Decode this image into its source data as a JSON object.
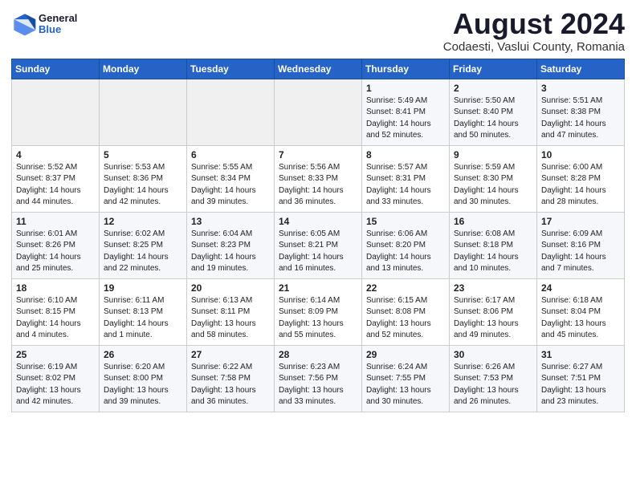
{
  "header": {
    "logo_general": "General",
    "logo_blue": "Blue",
    "main_title": "August 2024",
    "subtitle": "Codaesti, Vaslui County, Romania"
  },
  "days_of_week": [
    "Sunday",
    "Monday",
    "Tuesday",
    "Wednesday",
    "Thursday",
    "Friday",
    "Saturday"
  ],
  "weeks": [
    [
      {
        "day": "",
        "info": ""
      },
      {
        "day": "",
        "info": ""
      },
      {
        "day": "",
        "info": ""
      },
      {
        "day": "",
        "info": ""
      },
      {
        "day": "1",
        "info": "Sunrise: 5:49 AM\nSunset: 8:41 PM\nDaylight: 14 hours\nand 52 minutes."
      },
      {
        "day": "2",
        "info": "Sunrise: 5:50 AM\nSunset: 8:40 PM\nDaylight: 14 hours\nand 50 minutes."
      },
      {
        "day": "3",
        "info": "Sunrise: 5:51 AM\nSunset: 8:38 PM\nDaylight: 14 hours\nand 47 minutes."
      }
    ],
    [
      {
        "day": "4",
        "info": "Sunrise: 5:52 AM\nSunset: 8:37 PM\nDaylight: 14 hours\nand 44 minutes."
      },
      {
        "day": "5",
        "info": "Sunrise: 5:53 AM\nSunset: 8:36 PM\nDaylight: 14 hours\nand 42 minutes."
      },
      {
        "day": "6",
        "info": "Sunrise: 5:55 AM\nSunset: 8:34 PM\nDaylight: 14 hours\nand 39 minutes."
      },
      {
        "day": "7",
        "info": "Sunrise: 5:56 AM\nSunset: 8:33 PM\nDaylight: 14 hours\nand 36 minutes."
      },
      {
        "day": "8",
        "info": "Sunrise: 5:57 AM\nSunset: 8:31 PM\nDaylight: 14 hours\nand 33 minutes."
      },
      {
        "day": "9",
        "info": "Sunrise: 5:59 AM\nSunset: 8:30 PM\nDaylight: 14 hours\nand 30 minutes."
      },
      {
        "day": "10",
        "info": "Sunrise: 6:00 AM\nSunset: 8:28 PM\nDaylight: 14 hours\nand 28 minutes."
      }
    ],
    [
      {
        "day": "11",
        "info": "Sunrise: 6:01 AM\nSunset: 8:26 PM\nDaylight: 14 hours\nand 25 minutes."
      },
      {
        "day": "12",
        "info": "Sunrise: 6:02 AM\nSunset: 8:25 PM\nDaylight: 14 hours\nand 22 minutes."
      },
      {
        "day": "13",
        "info": "Sunrise: 6:04 AM\nSunset: 8:23 PM\nDaylight: 14 hours\nand 19 minutes."
      },
      {
        "day": "14",
        "info": "Sunrise: 6:05 AM\nSunset: 8:21 PM\nDaylight: 14 hours\nand 16 minutes."
      },
      {
        "day": "15",
        "info": "Sunrise: 6:06 AM\nSunset: 8:20 PM\nDaylight: 14 hours\nand 13 minutes."
      },
      {
        "day": "16",
        "info": "Sunrise: 6:08 AM\nSunset: 8:18 PM\nDaylight: 14 hours\nand 10 minutes."
      },
      {
        "day": "17",
        "info": "Sunrise: 6:09 AM\nSunset: 8:16 PM\nDaylight: 14 hours\nand 7 minutes."
      }
    ],
    [
      {
        "day": "18",
        "info": "Sunrise: 6:10 AM\nSunset: 8:15 PM\nDaylight: 14 hours\nand 4 minutes."
      },
      {
        "day": "19",
        "info": "Sunrise: 6:11 AM\nSunset: 8:13 PM\nDaylight: 14 hours\nand 1 minute."
      },
      {
        "day": "20",
        "info": "Sunrise: 6:13 AM\nSunset: 8:11 PM\nDaylight: 13 hours\nand 58 minutes."
      },
      {
        "day": "21",
        "info": "Sunrise: 6:14 AM\nSunset: 8:09 PM\nDaylight: 13 hours\nand 55 minutes."
      },
      {
        "day": "22",
        "info": "Sunrise: 6:15 AM\nSunset: 8:08 PM\nDaylight: 13 hours\nand 52 minutes."
      },
      {
        "day": "23",
        "info": "Sunrise: 6:17 AM\nSunset: 8:06 PM\nDaylight: 13 hours\nand 49 minutes."
      },
      {
        "day": "24",
        "info": "Sunrise: 6:18 AM\nSunset: 8:04 PM\nDaylight: 13 hours\nand 45 minutes."
      }
    ],
    [
      {
        "day": "25",
        "info": "Sunrise: 6:19 AM\nSunset: 8:02 PM\nDaylight: 13 hours\nand 42 minutes."
      },
      {
        "day": "26",
        "info": "Sunrise: 6:20 AM\nSunset: 8:00 PM\nDaylight: 13 hours\nand 39 minutes."
      },
      {
        "day": "27",
        "info": "Sunrise: 6:22 AM\nSunset: 7:58 PM\nDaylight: 13 hours\nand 36 minutes."
      },
      {
        "day": "28",
        "info": "Sunrise: 6:23 AM\nSunset: 7:56 PM\nDaylight: 13 hours\nand 33 minutes."
      },
      {
        "day": "29",
        "info": "Sunrise: 6:24 AM\nSunset: 7:55 PM\nDaylight: 13 hours\nand 30 minutes."
      },
      {
        "day": "30",
        "info": "Sunrise: 6:26 AM\nSunset: 7:53 PM\nDaylight: 13 hours\nand 26 minutes."
      },
      {
        "day": "31",
        "info": "Sunrise: 6:27 AM\nSunset: 7:51 PM\nDaylight: 13 hours\nand 23 minutes."
      }
    ]
  ]
}
